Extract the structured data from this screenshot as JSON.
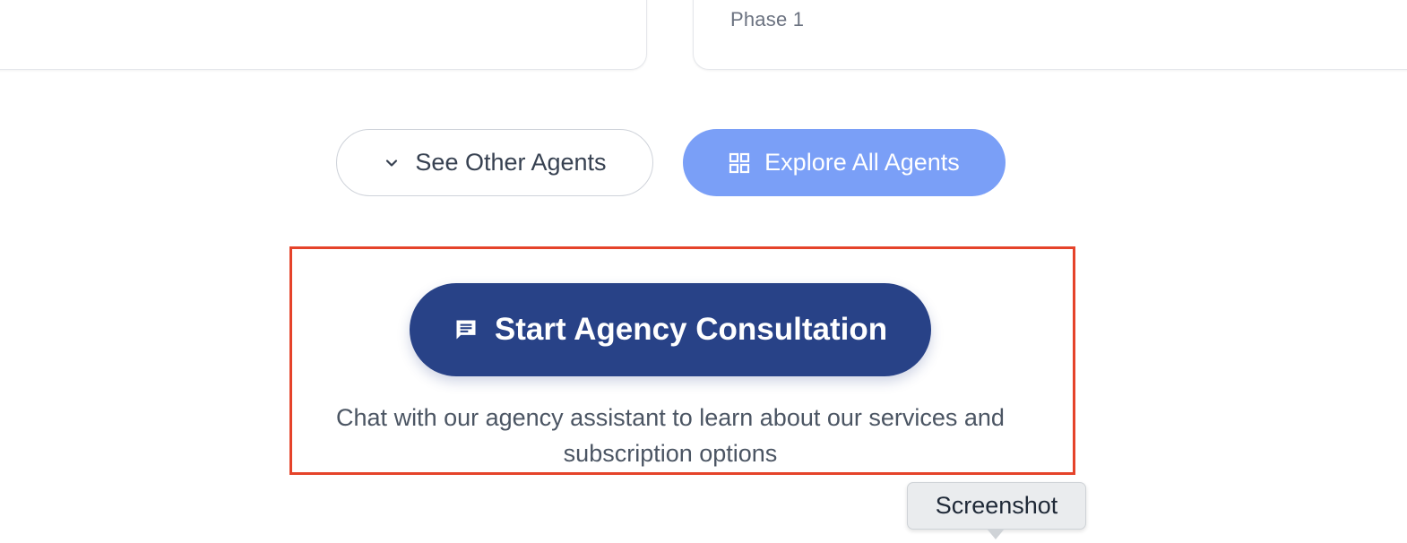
{
  "cards": {
    "right_card_label": "Phase 1"
  },
  "actions": {
    "see_other_agents_label": "See Other Agents",
    "explore_all_agents_label": "Explore All Agents",
    "see_other_agents_icon": "chevron-down-icon",
    "explore_all_agents_icon": "grid-icon"
  },
  "consultation": {
    "button_label": "Start Agency Consultation",
    "button_icon": "chat-icon",
    "description": "Chat with our agency assistant to learn about our services and subscription options"
  },
  "tooltip": {
    "text": "Screenshot"
  },
  "colors": {
    "primary_dark": "#284287",
    "primary_light": "#7a9ff7",
    "highlight": "#e5432a"
  }
}
